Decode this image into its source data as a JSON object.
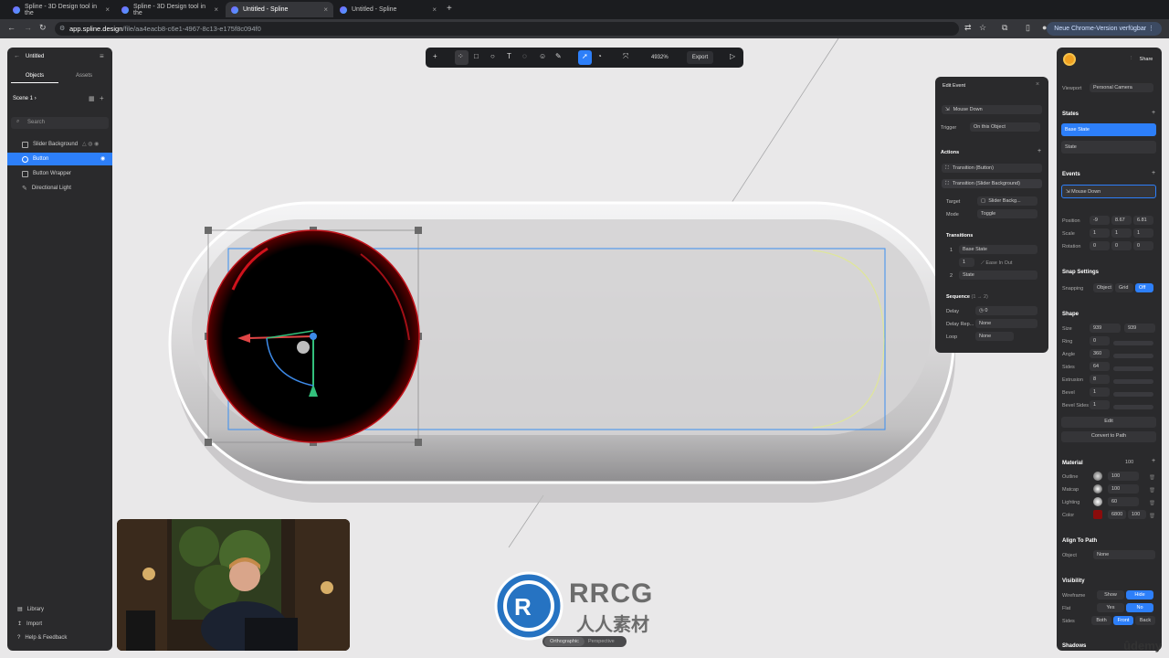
{
  "browser": {
    "tabs": [
      {
        "label": "Spline - 3D Design tool in the",
        "active": false
      },
      {
        "label": "Spline - 3D Design tool in the",
        "active": false
      },
      {
        "label": "Untitled - Spline",
        "active": true
      },
      {
        "label": "Untitled - Spline",
        "active": false
      }
    ],
    "url_host": "app.spline.design",
    "url_path": "/file/aa4eacb8-c6e1-4967-8c13-e175f8c094f0",
    "update_label": "Neue Chrome-Version verfügbar"
  },
  "left_panel": {
    "file_name": "Untitled",
    "tabs": [
      "Objects",
      "Assets"
    ],
    "scene_label": "Scene 1",
    "search_placeholder": "Search",
    "objects": [
      {
        "label": "Slider Background",
        "icon": "square-icon",
        "selected": false
      },
      {
        "label": "Button",
        "icon": "circle-icon",
        "selected": true
      },
      {
        "label": "Button Wrapper",
        "icon": "square-icon",
        "selected": false
      },
      {
        "label": "Directional Light",
        "icon": "light-icon",
        "selected": false
      }
    ],
    "footer": [
      "Library",
      "Import",
      "Help & Feedback"
    ]
  },
  "toolbar": {
    "zoom": "4932%",
    "export_label": "Export"
  },
  "edit_event": {
    "title": "Edit Event",
    "event_type": "Mouse Down",
    "trigger_label": "Trigger",
    "trigger_value": "On this Object",
    "actions_label": "Actions",
    "actions": [
      "Transition (Button)",
      "Transition (Slider Background)"
    ],
    "target_label": "Target",
    "target_value": "Slider Backg...",
    "mode_label": "Mode",
    "mode_value": "Toggle",
    "transitions_label": "Transitions",
    "transition_1": "Base State",
    "transition_1_num": "1",
    "transition_sub": "1",
    "ease": "Ease In Out",
    "transition_2": "State",
    "transition_2_num": "2",
    "sequence_label": "Sequence",
    "sequence_hint": "(1 → 2)",
    "delay_label": "Delay",
    "delay_value": "0",
    "delay_rep_label": "Delay Rep...",
    "delay_rep_value": "None",
    "loop_label": "Loop",
    "loop_value": "None"
  },
  "right_panel": {
    "share_label": "Share",
    "viewport_label": "Viewport",
    "viewport_value": "Personal Camera",
    "states_label": "States",
    "states": [
      "Base State",
      "State"
    ],
    "events_label": "Events",
    "event_item": "Mouse Down",
    "position_label": "Position",
    "position": [
      "-9",
      "8.67",
      "6.81"
    ],
    "scale_label": "Scale",
    "scale": [
      "1",
      "1",
      "1"
    ],
    "rotation_label": "Rotation",
    "rotation": [
      "0",
      "0",
      "0"
    ],
    "snap_label": "Snap Settings",
    "snapping_label": "Snapping",
    "snapping_options": [
      "Object",
      "Grid",
      "Off"
    ],
    "shape_label": "Shape",
    "size_label": "Size",
    "size": [
      "939",
      "939"
    ],
    "ring_label": "Ring",
    "ring_value": "0",
    "angle_label": "Angle",
    "angle_value": "360",
    "sides_label": "Sides",
    "sides_value": "64",
    "extrusion_label": "Extrusion",
    "extrusion_value": "8",
    "bevel_label": "Bevel",
    "bevel_value": "1",
    "bevel_sides_label": "Bevel Sides",
    "bevel_sides_value": "1",
    "edit_label": "Edit",
    "convert_label": "Convert to Path",
    "material_label": "Material",
    "material_value": "100",
    "layers": [
      {
        "label": "Outline",
        "value": "100"
      },
      {
        "label": "Matcap",
        "value": "100"
      },
      {
        "label": "Lighting",
        "value": "60"
      },
      {
        "label": "Color",
        "hex": "6800",
        "value": "100"
      }
    ],
    "align_label": "Align To Path",
    "object_label": "Object",
    "object_value": "None",
    "visibility_label": "Visibility",
    "wireframe_label": "Wireframe",
    "wireframe_options": [
      "Show",
      "Hide"
    ],
    "flat_label": "Flat",
    "flat_options": [
      "Yes",
      "No"
    ],
    "sides2_label": "Sides",
    "sides2_options": [
      "Both",
      "Front",
      "Back"
    ],
    "shadows_label": "Shadows"
  },
  "view_toggle": [
    "Orthographic",
    "Perspective"
  ],
  "watermark_top": "RRCG",
  "watermark_bottom": "人人素材",
  "udemy": "ûdemy",
  "colors": {
    "accent": "#2d7ff9",
    "panel": "#2a2a2c",
    "canvas": "#e9e8e9",
    "material_color": "#8a0c0c"
  }
}
